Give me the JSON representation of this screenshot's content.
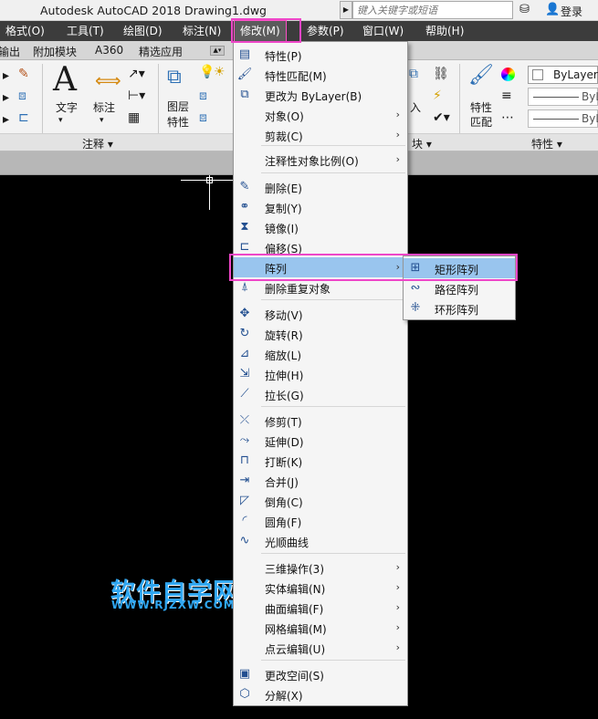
{
  "titlebar": {
    "app_title": "Autodesk AutoCAD 2018",
    "doc_title": "Drawing1.dwg",
    "search_placeholder": "键入关键字或短语",
    "login": "登录"
  },
  "menubar": {
    "items": [
      "格式(O)",
      "工具(T)",
      "绘图(D)",
      "标注(N)",
      "修改(M)",
      "参数(P)",
      "窗口(W)",
      "帮助(H)"
    ],
    "active": "修改(M)"
  },
  "ribbon_tabs": [
    "输出",
    "附加模块",
    "A360",
    "精选应用"
  ],
  "ribbon": {
    "tools": {
      "text": "文字",
      "dimension": "标注",
      "layer_props_1": "图层",
      "layer_props_2": "特性",
      "insert": "入",
      "match_props_1": "特性",
      "match_props_2": "匹配"
    },
    "panels": {
      "annotate": "注释 ▾",
      "block": "块 ▾",
      "properties": "特性 ▾"
    },
    "layer_value": "ByLayer",
    "line_value_1": "ByL",
    "line_value_2": "ByL"
  },
  "dropdown": {
    "items": [
      {
        "label": "特性(P)",
        "icon": "properties-icon",
        "glyph": "▤",
        "arrow": ""
      },
      {
        "label": "特性匹配(M)",
        "icon": "match-properties-icon",
        "glyph": "🖌",
        "arrow": ""
      },
      {
        "label": "更改为 ByLayer(B)",
        "icon": "bylayer-icon",
        "glyph": "⧉",
        "arrow": ""
      },
      {
        "label": "对象(O)",
        "icon": "",
        "glyph": "",
        "arrow": "›"
      },
      {
        "label": "剪裁(C)",
        "icon": "",
        "glyph": "",
        "arrow": "›"
      },
      {
        "label": "注释性对象比例(O)",
        "icon": "",
        "glyph": "",
        "arrow": "›"
      },
      {
        "label": "删除(E)",
        "icon": "erase-icon",
        "glyph": "✎",
        "arrow": ""
      },
      {
        "label": "复制(Y)",
        "icon": "copy-icon",
        "glyph": "⚭",
        "arrow": ""
      },
      {
        "label": "镜像(I)",
        "icon": "mirror-icon",
        "glyph": "⧗",
        "arrow": ""
      },
      {
        "label": "偏移(S)",
        "icon": "offset-icon",
        "glyph": "⊏",
        "arrow": ""
      },
      {
        "label": "阵列",
        "icon": "",
        "glyph": "",
        "arrow": "›"
      },
      {
        "label": "删除重复对象",
        "icon": "overkill-icon",
        "glyph": "⍋",
        "arrow": ""
      },
      {
        "label": "移动(V)",
        "icon": "move-icon",
        "glyph": "✥",
        "arrow": ""
      },
      {
        "label": "旋转(R)",
        "icon": "rotate-icon",
        "glyph": "↻",
        "arrow": ""
      },
      {
        "label": "缩放(L)",
        "icon": "scale-icon",
        "glyph": "⊿",
        "arrow": ""
      },
      {
        "label": "拉伸(H)",
        "icon": "stretch-icon",
        "glyph": "⇲",
        "arrow": ""
      },
      {
        "label": "拉长(G)",
        "icon": "lengthen-icon",
        "glyph": "⟋",
        "arrow": ""
      },
      {
        "label": "修剪(T)",
        "icon": "trim-icon",
        "glyph": "⤫",
        "arrow": ""
      },
      {
        "label": "延伸(D)",
        "icon": "extend-icon",
        "glyph": "⤳",
        "arrow": ""
      },
      {
        "label": "打断(K)",
        "icon": "break-icon",
        "glyph": "⊓",
        "arrow": ""
      },
      {
        "label": "合并(J)",
        "icon": "join-icon",
        "glyph": "⇥",
        "arrow": ""
      },
      {
        "label": "倒角(C)",
        "icon": "chamfer-icon",
        "glyph": "◸",
        "arrow": ""
      },
      {
        "label": "圆角(F)",
        "icon": "fillet-icon",
        "glyph": "◜",
        "arrow": ""
      },
      {
        "label": "光顺曲线",
        "icon": "blend-curves-icon",
        "glyph": "∿",
        "arrow": ""
      },
      {
        "label": "三维操作(3)",
        "icon": "",
        "glyph": "",
        "arrow": "›"
      },
      {
        "label": "实体编辑(N)",
        "icon": "",
        "glyph": "",
        "arrow": "›"
      },
      {
        "label": "曲面编辑(F)",
        "icon": "",
        "glyph": "",
        "arrow": "›"
      },
      {
        "label": "网格编辑(M)",
        "icon": "",
        "glyph": "",
        "arrow": "›"
      },
      {
        "label": "点云编辑(U)",
        "icon": "",
        "glyph": "",
        "arrow": "›"
      },
      {
        "label": "更改空间(S)",
        "icon": "change-space-icon",
        "glyph": "▣",
        "arrow": ""
      },
      {
        "label": "分解(X)",
        "icon": "explode-icon",
        "glyph": "⬡",
        "arrow": ""
      }
    ],
    "hovered": "阵列"
  },
  "submenu": {
    "items": [
      {
        "label": "矩形阵列",
        "icon": "rectangular-array-icon",
        "glyph": "⊞"
      },
      {
        "label": "路径阵列",
        "icon": "path-array-icon",
        "glyph": "∾"
      },
      {
        "label": "环形阵列",
        "icon": "polar-array-icon",
        "glyph": "⁜"
      }
    ],
    "hovered": "矩形阵列"
  },
  "watermark": {
    "cn": "软件自学网",
    "en": "WWW.RJZXW.COM"
  }
}
